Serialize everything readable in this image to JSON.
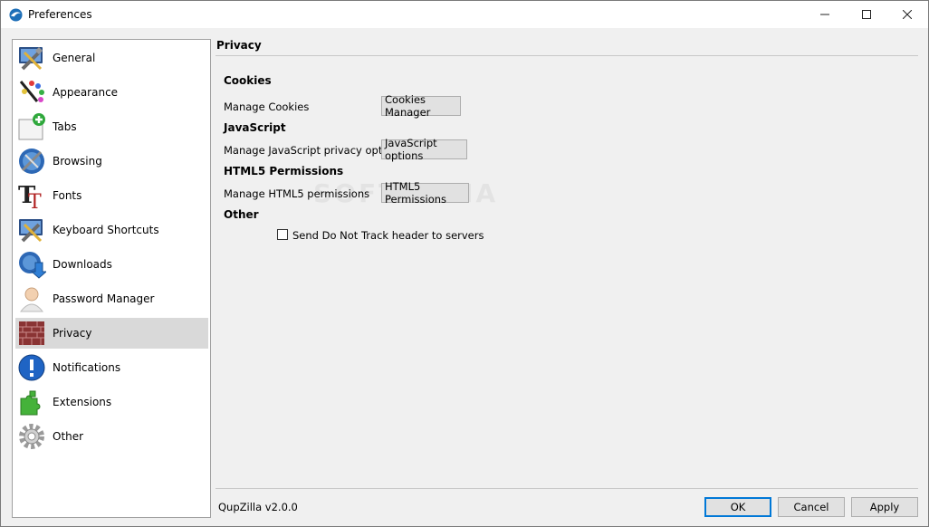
{
  "window": {
    "title": "Preferences"
  },
  "sidebar": {
    "items": [
      {
        "label": "General",
        "icon": "general-settings-icon"
      },
      {
        "label": "Appearance",
        "icon": "appearance-palette-icon"
      },
      {
        "label": "Tabs",
        "icon": "tabs-add-icon"
      },
      {
        "label": "Browsing",
        "icon": "browsing-globe-icon"
      },
      {
        "label": "Fonts",
        "icon": "fonts-icon"
      },
      {
        "label": "Keyboard Shortcuts",
        "icon": "keyboard-shortcuts-icon"
      },
      {
        "label": "Downloads",
        "icon": "downloads-icon"
      },
      {
        "label": "Password Manager",
        "icon": "password-manager-icon"
      },
      {
        "label": "Privacy",
        "icon": "privacy-wall-icon",
        "selected": true
      },
      {
        "label": "Notifications",
        "icon": "notifications-icon"
      },
      {
        "label": "Extensions",
        "icon": "extensions-puzzle-icon"
      },
      {
        "label": "Other",
        "icon": "other-gear-icon"
      }
    ]
  },
  "main": {
    "section_title": "Privacy",
    "cookies": {
      "heading": "Cookies",
      "label": "Manage Cookies",
      "button": "Cookies Manager"
    },
    "javascript": {
      "heading": "JavaScript",
      "label": "Manage JavaScript privacy options",
      "button": "JavaScript options"
    },
    "html5": {
      "heading": "HTML5 Permissions",
      "label": "Manage HTML5 permissions",
      "button": "HTML5 Permissions"
    },
    "other": {
      "heading": "Other",
      "dnt_label": "Send Do Not Track header to servers",
      "dnt_checked": false
    }
  },
  "watermark": "SOFTPEDIA",
  "footer": {
    "version": "QupZilla v2.0.0",
    "ok": "OK",
    "cancel": "Cancel",
    "apply": "Apply"
  },
  "colors": {
    "selection": "#d9d9d9",
    "accent": "#0078d7"
  }
}
